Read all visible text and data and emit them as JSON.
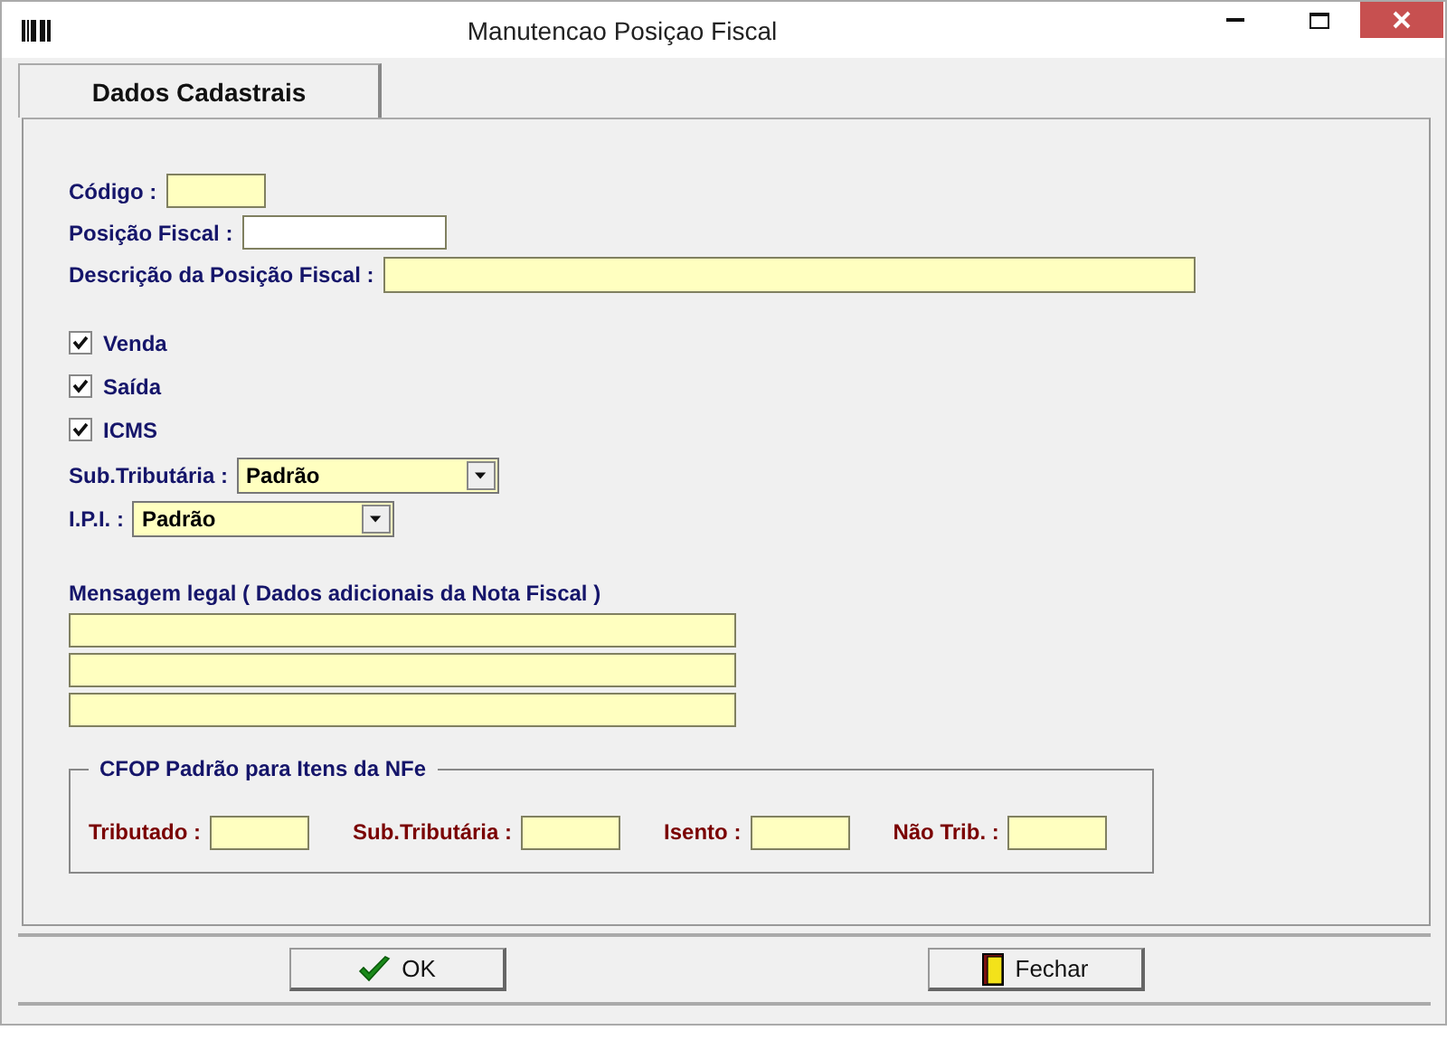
{
  "window": {
    "title": "Manutencao Posiçao Fiscal"
  },
  "tabs": [
    {
      "label": "Dados Cadastrais",
      "selected": true
    }
  ],
  "fields": [
    {
      "label": "Código :",
      "highlighted": true
    },
    {
      "label": "Posição Fiscal :",
      "highlighted": false
    },
    {
      "label": "Descrição da Posição Fiscal :",
      "highlighted": true
    }
  ],
  "checkboxes": [
    {
      "label": "Venda",
      "checked": true
    },
    {
      "label": "Saída",
      "checked": true
    },
    {
      "label": "ICMS",
      "checked": true
    }
  ],
  "selects": [
    {
      "label": "Sub.Tributária :",
      "value": "Padrão"
    },
    {
      "label": "I.P.I. :",
      "value": "Padrão"
    }
  ],
  "legal_message": {
    "label": "Mensagem legal ( Dados adicionais da Nota Fiscal )",
    "lines": [
      {
        "kind": "line"
      },
      {
        "kind": "line"
      },
      {
        "kind": "line"
      }
    ]
  },
  "cfop": {
    "title": "CFOP Padrão para Itens da NFe",
    "fields": [
      {
        "label": "Tributado :"
      },
      {
        "label": "Sub.Tributária :"
      },
      {
        "label": "Isento :"
      },
      {
        "label": "Não Trib. :"
      }
    ]
  },
  "buttons": [
    {
      "label": "OK",
      "kind": "ok"
    },
    {
      "label": "Fechar",
      "kind": "close"
    }
  ]
}
